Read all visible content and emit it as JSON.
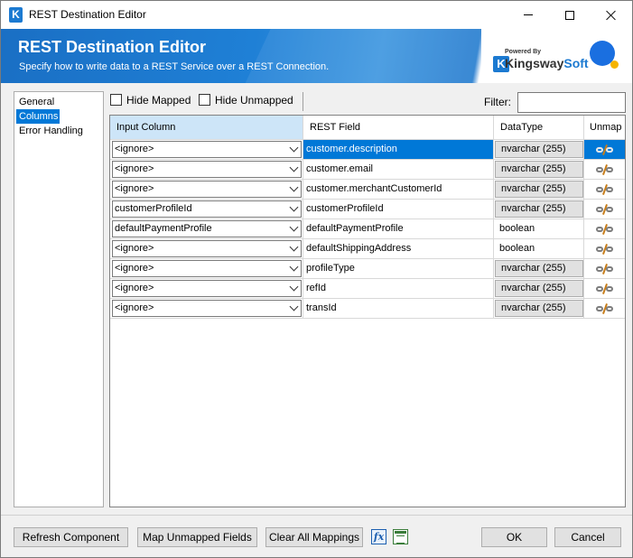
{
  "window": {
    "title": "REST Destination Editor"
  },
  "banner": {
    "title": "REST Destination Editor",
    "subtitle": "Specify how to write data to a REST Service over a REST Connection.",
    "powered_by": "Powered By",
    "brand_first": "Kingsway",
    "brand_second": "Soft",
    "brand_logo_letter": "K"
  },
  "nav": {
    "items": [
      {
        "label": "General"
      },
      {
        "label": "Columns"
      },
      {
        "label": "Error Handling"
      }
    ],
    "selected": "Columns"
  },
  "toolbar": {
    "hide_mapped": "Hide Mapped",
    "hide_unmapped": "Hide Unmapped",
    "filter_label": "Filter:",
    "filter_value": ""
  },
  "grid": {
    "headers": [
      "Input Column",
      "REST Field",
      "DataType",
      "Unmap"
    ],
    "rows": [
      {
        "input": "<ignore>",
        "field": "customer.description",
        "type": "nvarchar (255)",
        "type_editable": true,
        "selected": true
      },
      {
        "input": "<ignore>",
        "field": "customer.email",
        "type": "nvarchar (255)",
        "type_editable": true
      },
      {
        "input": "<ignore>",
        "field": "customer.merchantCustomerId",
        "type": "nvarchar (255)",
        "type_editable": true
      },
      {
        "input": "customerProfileId",
        "field": "customerProfileId",
        "type": "nvarchar (255)",
        "type_editable": true
      },
      {
        "input": "defaultPaymentProfile",
        "field": "defaultPaymentProfile",
        "type": "boolean",
        "type_editable": false
      },
      {
        "input": "<ignore>",
        "field": "defaultShippingAddress",
        "type": "boolean",
        "type_editable": false
      },
      {
        "input": "<ignore>",
        "field": "profileType",
        "type": "nvarchar (255)",
        "type_editable": true
      },
      {
        "input": "<ignore>",
        "field": "refId",
        "type": "nvarchar (255)",
        "type_editable": true
      },
      {
        "input": "<ignore>",
        "field": "transId",
        "type": "nvarchar (255)",
        "type_editable": true
      }
    ]
  },
  "buttons": {
    "refresh": "Refresh Component",
    "map_unmapped": "Map Unmapped Fields",
    "clear_all": "Clear All Mappings",
    "fx_glyph": "fx",
    "ok": "OK",
    "cancel": "Cancel"
  },
  "colors": {
    "accent": "#0078d7",
    "brand_blue": "#1c7ad1"
  }
}
